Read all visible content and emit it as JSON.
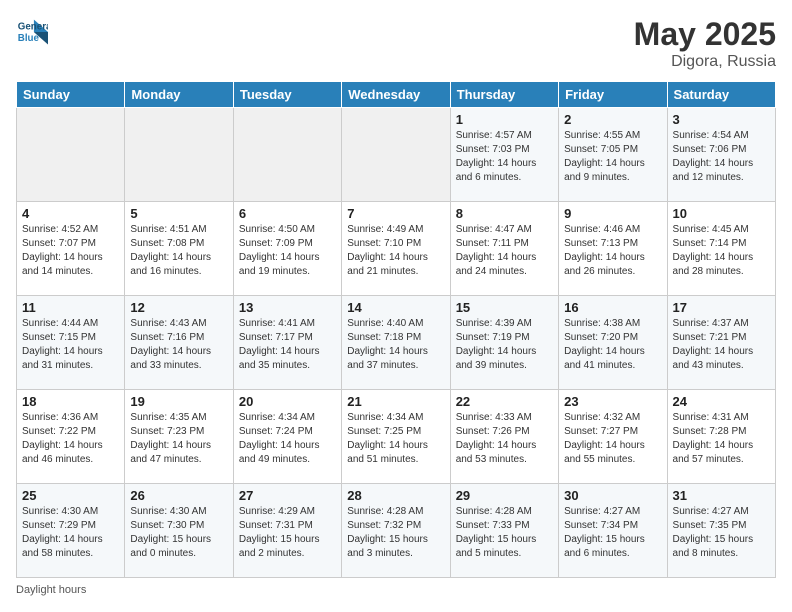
{
  "header": {
    "logo_line1": "General",
    "logo_line2": "Blue",
    "month": "May 2025",
    "location": "Digora, Russia"
  },
  "weekdays": [
    "Sunday",
    "Monday",
    "Tuesday",
    "Wednesday",
    "Thursday",
    "Friday",
    "Saturday"
  ],
  "weeks": [
    [
      {
        "day": "",
        "info": ""
      },
      {
        "day": "",
        "info": ""
      },
      {
        "day": "",
        "info": ""
      },
      {
        "day": "",
        "info": ""
      },
      {
        "day": "1",
        "info": "Sunrise: 4:57 AM\nSunset: 7:03 PM\nDaylight: 14 hours and 6 minutes."
      },
      {
        "day": "2",
        "info": "Sunrise: 4:55 AM\nSunset: 7:05 PM\nDaylight: 14 hours and 9 minutes."
      },
      {
        "day": "3",
        "info": "Sunrise: 4:54 AM\nSunset: 7:06 PM\nDaylight: 14 hours and 12 minutes."
      }
    ],
    [
      {
        "day": "4",
        "info": "Sunrise: 4:52 AM\nSunset: 7:07 PM\nDaylight: 14 hours and 14 minutes."
      },
      {
        "day": "5",
        "info": "Sunrise: 4:51 AM\nSunset: 7:08 PM\nDaylight: 14 hours and 16 minutes."
      },
      {
        "day": "6",
        "info": "Sunrise: 4:50 AM\nSunset: 7:09 PM\nDaylight: 14 hours and 19 minutes."
      },
      {
        "day": "7",
        "info": "Sunrise: 4:49 AM\nSunset: 7:10 PM\nDaylight: 14 hours and 21 minutes."
      },
      {
        "day": "8",
        "info": "Sunrise: 4:47 AM\nSunset: 7:11 PM\nDaylight: 14 hours and 24 minutes."
      },
      {
        "day": "9",
        "info": "Sunrise: 4:46 AM\nSunset: 7:13 PM\nDaylight: 14 hours and 26 minutes."
      },
      {
        "day": "10",
        "info": "Sunrise: 4:45 AM\nSunset: 7:14 PM\nDaylight: 14 hours and 28 minutes."
      }
    ],
    [
      {
        "day": "11",
        "info": "Sunrise: 4:44 AM\nSunset: 7:15 PM\nDaylight: 14 hours and 31 minutes."
      },
      {
        "day": "12",
        "info": "Sunrise: 4:43 AM\nSunset: 7:16 PM\nDaylight: 14 hours and 33 minutes."
      },
      {
        "day": "13",
        "info": "Sunrise: 4:41 AM\nSunset: 7:17 PM\nDaylight: 14 hours and 35 minutes."
      },
      {
        "day": "14",
        "info": "Sunrise: 4:40 AM\nSunset: 7:18 PM\nDaylight: 14 hours and 37 minutes."
      },
      {
        "day": "15",
        "info": "Sunrise: 4:39 AM\nSunset: 7:19 PM\nDaylight: 14 hours and 39 minutes."
      },
      {
        "day": "16",
        "info": "Sunrise: 4:38 AM\nSunset: 7:20 PM\nDaylight: 14 hours and 41 minutes."
      },
      {
        "day": "17",
        "info": "Sunrise: 4:37 AM\nSunset: 7:21 PM\nDaylight: 14 hours and 43 minutes."
      }
    ],
    [
      {
        "day": "18",
        "info": "Sunrise: 4:36 AM\nSunset: 7:22 PM\nDaylight: 14 hours and 46 minutes."
      },
      {
        "day": "19",
        "info": "Sunrise: 4:35 AM\nSunset: 7:23 PM\nDaylight: 14 hours and 47 minutes."
      },
      {
        "day": "20",
        "info": "Sunrise: 4:34 AM\nSunset: 7:24 PM\nDaylight: 14 hours and 49 minutes."
      },
      {
        "day": "21",
        "info": "Sunrise: 4:34 AM\nSunset: 7:25 PM\nDaylight: 14 hours and 51 minutes."
      },
      {
        "day": "22",
        "info": "Sunrise: 4:33 AM\nSunset: 7:26 PM\nDaylight: 14 hours and 53 minutes."
      },
      {
        "day": "23",
        "info": "Sunrise: 4:32 AM\nSunset: 7:27 PM\nDaylight: 14 hours and 55 minutes."
      },
      {
        "day": "24",
        "info": "Sunrise: 4:31 AM\nSunset: 7:28 PM\nDaylight: 14 hours and 57 minutes."
      }
    ],
    [
      {
        "day": "25",
        "info": "Sunrise: 4:30 AM\nSunset: 7:29 PM\nDaylight: 14 hours and 58 minutes."
      },
      {
        "day": "26",
        "info": "Sunrise: 4:30 AM\nSunset: 7:30 PM\nDaylight: 15 hours and 0 minutes."
      },
      {
        "day": "27",
        "info": "Sunrise: 4:29 AM\nSunset: 7:31 PM\nDaylight: 15 hours and 2 minutes."
      },
      {
        "day": "28",
        "info": "Sunrise: 4:28 AM\nSunset: 7:32 PM\nDaylight: 15 hours and 3 minutes."
      },
      {
        "day": "29",
        "info": "Sunrise: 4:28 AM\nSunset: 7:33 PM\nDaylight: 15 hours and 5 minutes."
      },
      {
        "day": "30",
        "info": "Sunrise: 4:27 AM\nSunset: 7:34 PM\nDaylight: 15 hours and 6 minutes."
      },
      {
        "day": "31",
        "info": "Sunrise: 4:27 AM\nSunset: 7:35 PM\nDaylight: 15 hours and 8 minutes."
      }
    ]
  ],
  "footer": {
    "note": "Daylight hours"
  }
}
